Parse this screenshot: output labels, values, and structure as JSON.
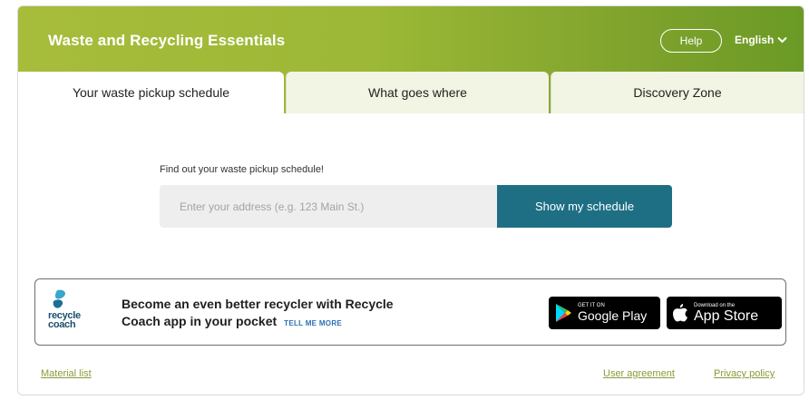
{
  "header": {
    "title": "Waste and Recycling Essentials",
    "help_label": "Help",
    "language": "English"
  },
  "tabs": [
    {
      "label": "Your waste pickup schedule",
      "active": true
    },
    {
      "label": "What goes where",
      "active": false
    },
    {
      "label": "Discovery Zone",
      "active": false
    }
  ],
  "search": {
    "label": "Find out your waste pickup schedule!",
    "placeholder": "Enter your address (e.g. 123 Main St.)",
    "value": "",
    "button_label": "Show my schedule"
  },
  "banner": {
    "logo_text_line1": "recycle",
    "logo_text_line2": "coach",
    "line1": "Become an even better recycler with Recycle",
    "line2": "Coach app in your pocket",
    "link": "TELL ME MORE",
    "google_small": "GET IT ON",
    "google_big": "Google Play",
    "apple_small": "Download on the",
    "apple_big": "App Store"
  },
  "footer": {
    "material_list": "Material list",
    "user_agreement": "User agreement",
    "privacy_policy": "Privacy policy"
  },
  "colors": {
    "header_start": "#a7bc3b",
    "header_end": "#6a9a25",
    "button": "#1f6f84",
    "footer_link": "#8a9a3a",
    "tab_inactive": "#f2f4e4"
  },
  "icons": {
    "language": "chevron-down-icon",
    "google": "google-play-icon",
    "apple": "apple-icon",
    "logo": "recycle-coach-logo"
  }
}
